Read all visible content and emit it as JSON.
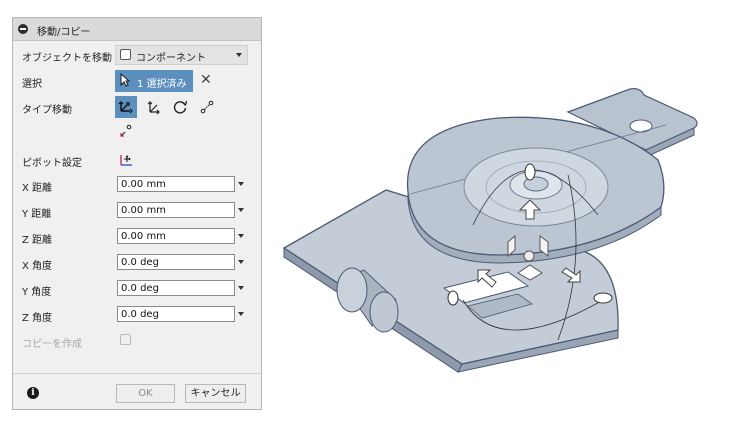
{
  "dialog": {
    "title": "移動/コピー",
    "object_move_label": "オブジェクトを移動",
    "object_move_value": "コンポーネント",
    "selection_label": "選択",
    "selection_value": "1 選択済み",
    "type_move_label": "タイプ移動",
    "pivot_label": "ピボット設定",
    "fields": [
      {
        "label": "X 距離",
        "value": "0.00 mm"
      },
      {
        "label": "Y 距離",
        "value": "0.00 mm"
      },
      {
        "label": "Z 距離",
        "value": "0.00 mm"
      },
      {
        "label": "X 角度",
        "value": "0.0 deg"
      },
      {
        "label": "Y 角度",
        "value": "0.0 deg"
      },
      {
        "label": "Z 角度",
        "value": "0.0 deg"
      }
    ],
    "create_copy_label": "コピーを作成",
    "ok_label": "OK",
    "cancel_label": "キャンセル",
    "info_glyph": "i"
  },
  "colors": {
    "accent": "#5b8fbd",
    "model": "#b8c3cf",
    "model_edge": "#4a5a75"
  },
  "icons": [
    "collapse-icon",
    "component-icon",
    "cursor-icon",
    "clear-x-icon",
    "free-move-icon",
    "translate-icon",
    "rotate-icon",
    "point-to-point-icon",
    "point-to-position-icon",
    "pivot-icon",
    "info-icon"
  ]
}
